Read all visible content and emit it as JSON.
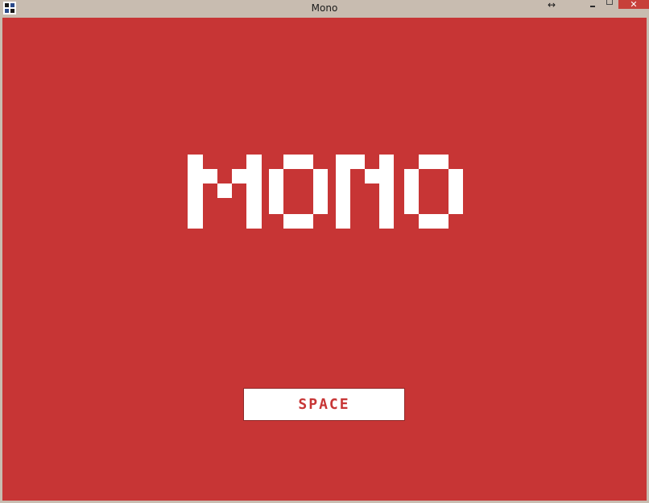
{
  "window": {
    "title": "Mono",
    "resize_glyph": "↔",
    "close_glyph": "✕",
    "app_icon": "game-app-icon"
  },
  "game": {
    "logo_text": "MONO",
    "start_button_label": "SPACE",
    "background_color": "#c73535",
    "foreground_color": "#ffffff"
  }
}
